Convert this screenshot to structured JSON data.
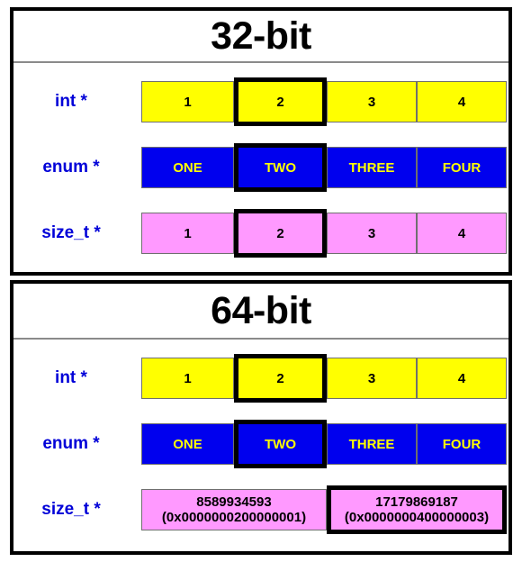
{
  "colors": {
    "int_cell": "#ffff00",
    "enum_cell": "#0000ee",
    "enum_text": "#ffff00",
    "size_t_cell": "#ff99ff",
    "label_text": "#0000d8",
    "highlight_border": "#000000",
    "panel_border": "#000000"
  },
  "panels": [
    {
      "title": "32-bit",
      "rows": [
        {
          "label": "int *",
          "style": "yellow",
          "cells": [
            {
              "text": "1",
              "highlighted": false
            },
            {
              "text": "2",
              "highlighted": true
            },
            {
              "text": "3",
              "highlighted": false
            },
            {
              "text": "4",
              "highlighted": false
            }
          ]
        },
        {
          "label": "enum *",
          "style": "blue",
          "cells": [
            {
              "text": "ONE",
              "highlighted": false
            },
            {
              "text": "TWO",
              "highlighted": true
            },
            {
              "text": "THREE",
              "highlighted": false
            },
            {
              "text": "FOUR",
              "highlighted": false
            }
          ]
        },
        {
          "label": "size_t *",
          "style": "pink",
          "cells": [
            {
              "text": "1",
              "highlighted": false
            },
            {
              "text": "2",
              "highlighted": true
            },
            {
              "text": "3",
              "highlighted": false
            },
            {
              "text": "4",
              "highlighted": false
            }
          ]
        }
      ]
    },
    {
      "title": "64-bit",
      "rows": [
        {
          "label": "int *",
          "style": "yellow",
          "cells": [
            {
              "text": "1",
              "highlighted": false
            },
            {
              "text": "2",
              "highlighted": true
            },
            {
              "text": "3",
              "highlighted": false
            },
            {
              "text": "4",
              "highlighted": false
            }
          ]
        },
        {
          "label": "enum *",
          "style": "blue",
          "cells": [
            {
              "text": "ONE",
              "highlighted": false
            },
            {
              "text": "TWO",
              "highlighted": true
            },
            {
              "text": "THREE",
              "highlighted": false
            },
            {
              "text": "FOUR",
              "highlighted": false
            }
          ]
        },
        {
          "label": "size_t *",
          "style": "pink",
          "wide": true,
          "cells": [
            {
              "decimal": "8589934593",
              "hex": "(0x0000000200000001)",
              "highlighted": false
            },
            {
              "decimal": "17179869187",
              "hex": "(0x0000000400000003)",
              "highlighted": true
            }
          ]
        }
      ]
    }
  ]
}
